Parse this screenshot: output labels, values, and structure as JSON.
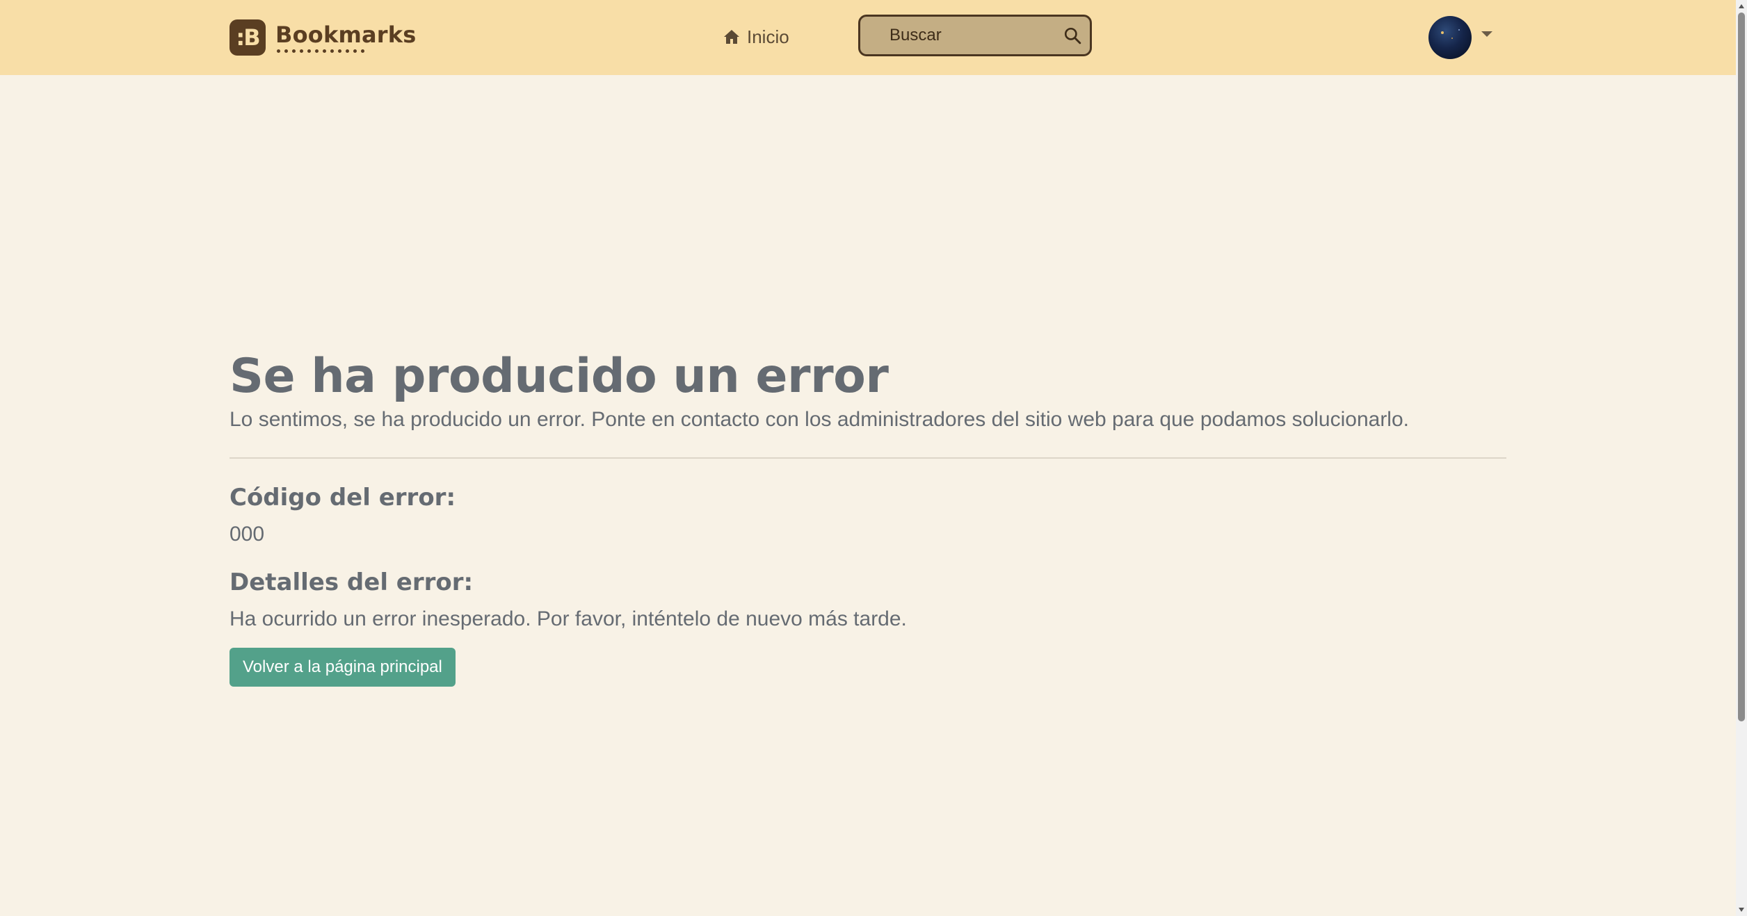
{
  "navbar": {
    "brand": {
      "logo_glyph": ":B",
      "name": "Bookmarks"
    },
    "home_link": {
      "icon": "home-icon",
      "label": "Inicio"
    },
    "search": {
      "placeholder": "Buscar",
      "value": "",
      "icon": "search-icon"
    },
    "user_menu": {
      "avatar": "avatar",
      "icon": "caret-down-icon"
    }
  },
  "error_page": {
    "title": "Se ha producido un error",
    "lead": "Lo sentimos, se ha producido un error. Ponte en contacto con los administradores del sitio web para que podamos solucionarlo.",
    "code_heading": "Código del error:",
    "code_value": "000",
    "details_heading": "Detalles del error:",
    "details_text": "Ha ocurrido un error inesperado. Por favor, inténtelo de nuevo más tarde.",
    "back_button": "Volver a la página principal"
  },
  "colors": {
    "navbar_bg": "#f8dea7",
    "page_bg": "#f8f2e6",
    "brand": "#5a3e22",
    "text_muted": "#656b72",
    "button_bg": "#53a18a",
    "search_bg": "#c4ae84"
  }
}
